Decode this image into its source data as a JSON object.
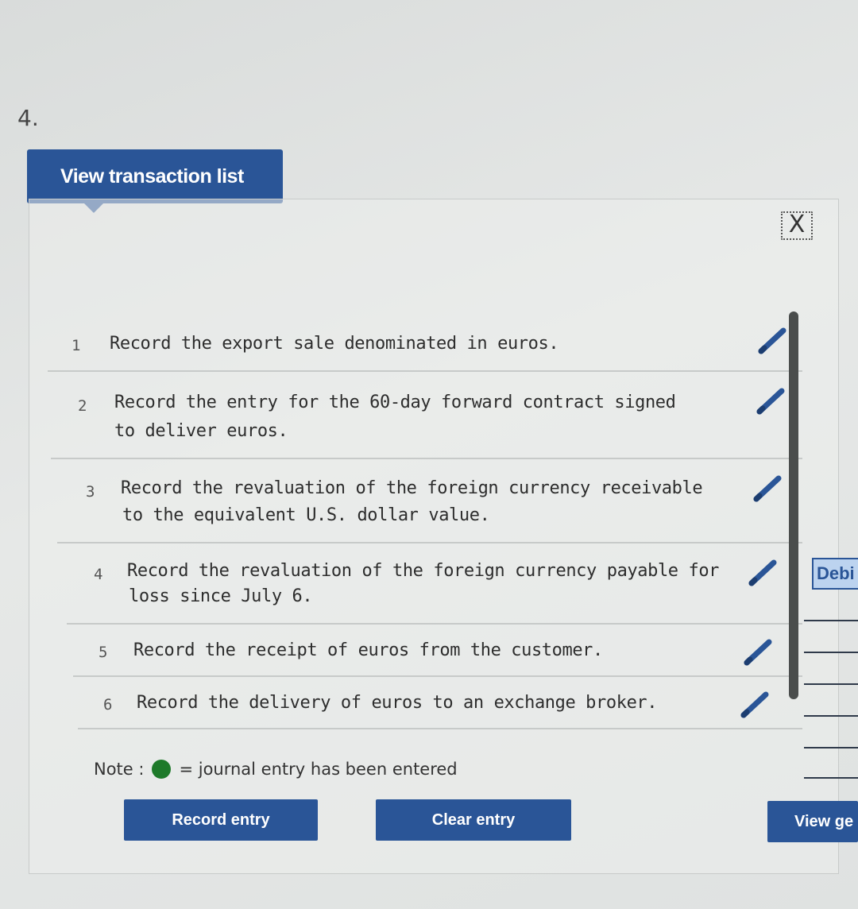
{
  "question_number": "4.",
  "view_transaction_list_label": "View transaction list",
  "close_symbol": "X",
  "transactions": [
    {
      "num": "1",
      "text": "Record the export sale denominated in euros."
    },
    {
      "num": "2",
      "text_line1": "Record the entry for the 60-day forward contract signed",
      "text_line2": "to deliver euros."
    },
    {
      "num": "3",
      "text_line1": "Record the revaluation of the foreign currency receivable",
      "text_line2": "to the equivalent U.S. dollar value."
    },
    {
      "num": "4",
      "text_line1": "Record the revaluation of the foreign currency payable for",
      "text_line2": "loss since July 6."
    },
    {
      "num": "5",
      "text": "Record the receipt of euros from the customer."
    },
    {
      "num": "6",
      "text": "Record the delivery of euros to an exchange broker."
    }
  ],
  "note": {
    "prefix": "Note :",
    "suffix": "= journal entry has been entered",
    "dot_color": "#1e7a2a"
  },
  "buttons": {
    "record_entry": "Record entry",
    "clear_entry": "Clear entry",
    "view_general": "View ge"
  },
  "background_table": {
    "debit_header": "Debi"
  },
  "colors": {
    "accent": "#2a5597",
    "entered_indicator": "#1e7a2a"
  },
  "icons": {
    "edit": "pencil-icon",
    "close": "close-icon",
    "entered": "green-dot-icon"
  }
}
